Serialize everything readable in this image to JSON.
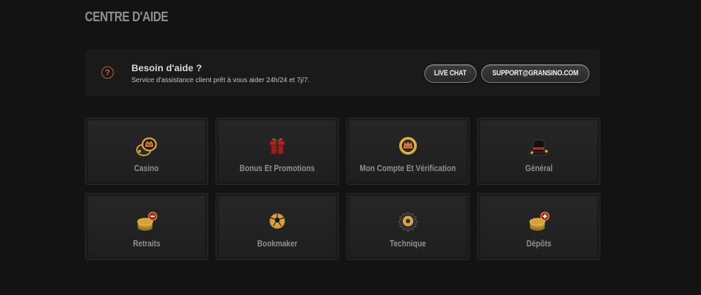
{
  "page": {
    "title": "CENTRE D'AIDE"
  },
  "help": {
    "icon": "question-circle-icon",
    "title": "Besoin d'aide ?",
    "subtitle": "Service d'assistance client prêt à vous aider 24h/24 et 7j/7.",
    "live_chat_label": "LIVE CHAT",
    "email_label": "SUPPORT@GRANSINO.COM"
  },
  "categories": [
    {
      "label": "Casino",
      "icon": "casino-chips-icon"
    },
    {
      "label": "Bonus Et Promotions",
      "icon": "gift-box-icon"
    },
    {
      "label": "Mon Compte Et Vérification",
      "icon": "gold-coin-crown-icon"
    },
    {
      "label": "Général",
      "icon": "top-hat-icon"
    },
    {
      "label": "Retraits",
      "icon": "coin-stack-minus-icon"
    },
    {
      "label": "Bookmaker",
      "icon": "football-icon"
    },
    {
      "label": "Technique",
      "icon": "gear-icon"
    },
    {
      "label": "Dépôts",
      "icon": "coin-stack-plus-icon"
    }
  ],
  "colors": {
    "background": "#131313",
    "accent": "#c8662f",
    "gold": "#d4a23a",
    "red": "#b3261e"
  }
}
